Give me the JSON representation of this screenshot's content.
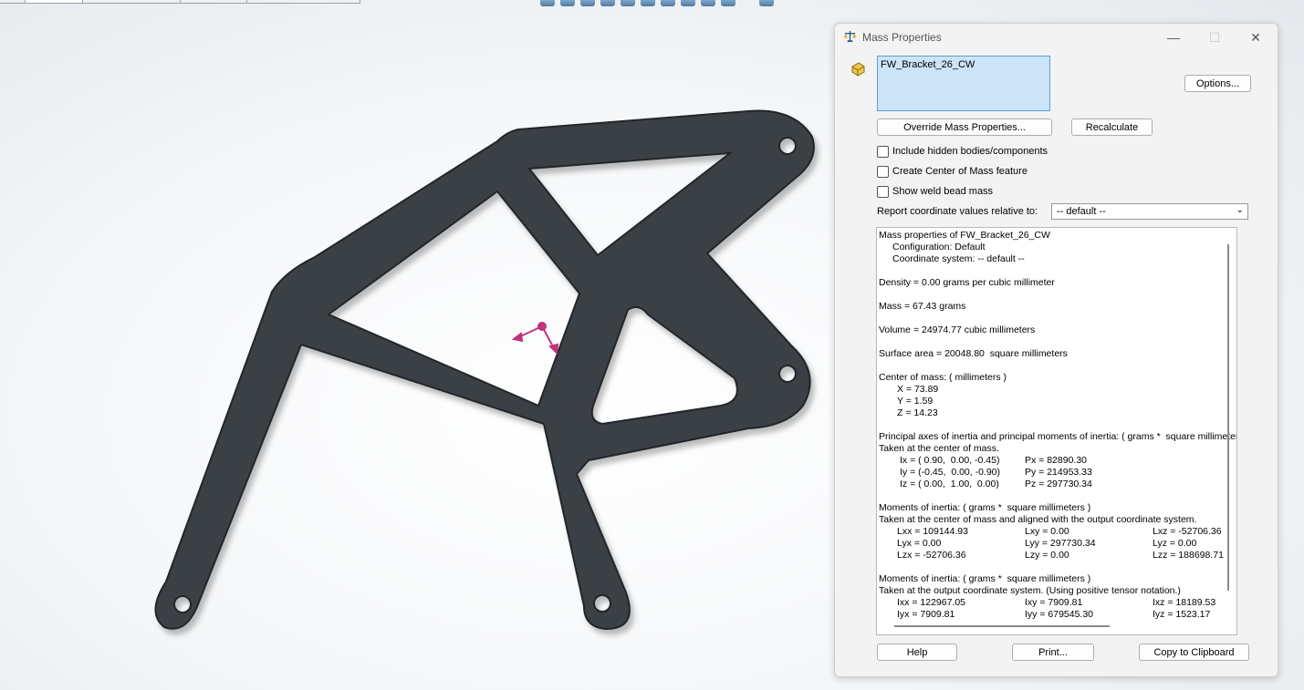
{
  "colors": {
    "part": "#3b3f45",
    "part_edge": "#24272b",
    "triad": "#c2337a",
    "selection_bg": "#cce4f7"
  },
  "dialog": {
    "title": "Mass Properties",
    "selected_item": "FW_Bracket_26_CW",
    "buttons": {
      "options": "Options...",
      "override": "Override Mass Properties...",
      "recalculate": "Recalculate",
      "help": "Help",
      "print": "Print...",
      "copy": "Copy to Clipboard"
    },
    "checkboxes": [
      {
        "label": "Include hidden bodies/components",
        "checked": false
      },
      {
        "label": "Create Center of Mass feature",
        "checked": false
      },
      {
        "label": "Show weld bead mass",
        "checked": false
      }
    ],
    "coord_label": "Report coordinate values relative to:",
    "coord_value": "-- default --",
    "results": {
      "header": "Mass properties of FW_Bracket_26_CW",
      "configuration": "Configuration: Default",
      "coord_system": "Coordinate system: -- default --",
      "density": "Density = 0.00 grams per cubic millimeter",
      "mass": "Mass = 67.43 grams",
      "volume": "Volume = 24974.77 cubic millimeters",
      "surface_area": "Surface area = 20048.80  square millimeters",
      "com_title": "Center of mass: ( millimeters )",
      "com_x": "X = 73.89",
      "com_y": "Y = 1.59",
      "com_z": "Z = 14.23",
      "principal_title": "Principal axes of inertia and principal moments of inertia: ( grams *  square millimeters )",
      "principal_taken": "Taken at the center of mass.",
      "ix": "Ix = ( 0.90,  0.00, -0.45)",
      "iy": "Iy = (-0.45,  0.00, -0.90)",
      "iz": "Iz = ( 0.00,  1.00,  0.00)",
      "px": "Px = 82890.30",
      "py": "Py = 214953.33",
      "pz": "Pz = 297730.34",
      "moi1_title": "Moments of inertia: ( grams *  square millimeters )",
      "moi1_taken": "Taken at the center of mass and aligned with the output coordinate system.",
      "lxx": "Lxx = 109144.93",
      "lxy": "Lxy = 0.00",
      "lxz": "Lxz = -52706.36",
      "lyx": "Lyx = 0.00",
      "lyy": "Lyy = 297730.34",
      "lyz": "Lyz = 0.00",
      "lzx": "Lzx = -52706.36",
      "lzy": "Lzy = 0.00",
      "lzz": "Lzz = 188698.71",
      "moi2_title": "Moments of inertia: ( grams *  square millimeters )",
      "moi2_taken": "Taken at the output coordinate system. (Using positive tensor notation.)",
      "ixx": "Ixx = 122967.05",
      "ixy": "Ixy = 7909.81",
      "ixz": "Ixz = 18189.53",
      "iyx": "Iyx = 7909.81",
      "iyy": "Iyy = 679545.30",
      "iyz": "Iyz = 1523.17"
    }
  }
}
